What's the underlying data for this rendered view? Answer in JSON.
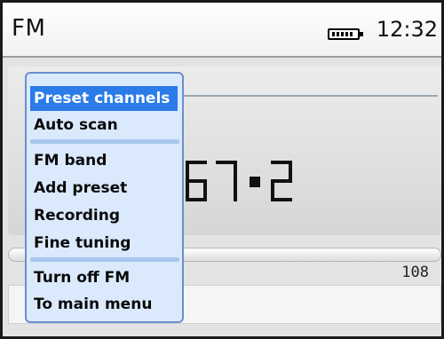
{
  "header": {
    "title": "FM",
    "time": "12:32",
    "battery_icon": "battery-full-icon"
  },
  "tuner": {
    "frequency": "967.2",
    "max_frequency": "108",
    "segment_color": "#111111"
  },
  "menu": {
    "items": [
      {
        "label": "Preset channels",
        "selected": true
      },
      {
        "label": "Auto scan"
      },
      {
        "label": "FM band"
      },
      {
        "label": "Add preset"
      },
      {
        "label": "Recording"
      },
      {
        "label": "Fine tuning"
      },
      {
        "label": "Turn off FM"
      },
      {
        "label": "To main menu"
      }
    ],
    "selection_color": "#2b7be8",
    "background_color": "#dbe9fd"
  }
}
